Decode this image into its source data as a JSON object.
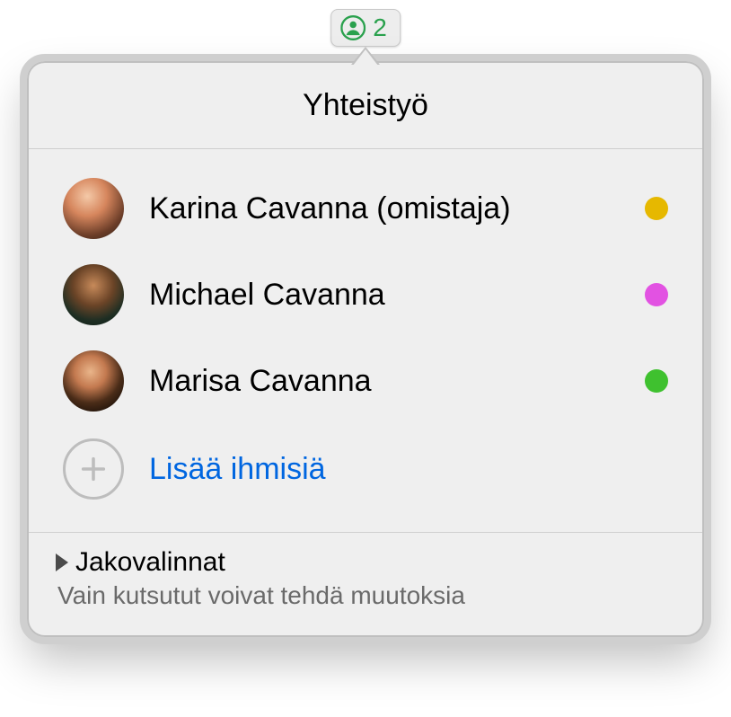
{
  "badge": {
    "count": "2"
  },
  "header": {
    "title": "Yhteistyö"
  },
  "participants": [
    {
      "name": "Karina Cavanna (omistaja)",
      "dot": "#e6b800"
    },
    {
      "name": "Michael Cavanna",
      "dot": "#e252e2"
    },
    {
      "name": "Marisa Cavanna",
      "dot": "#3fc12f"
    }
  ],
  "add": {
    "label": "Lisää ihmisiä"
  },
  "footer": {
    "title": "Jakovalinnat",
    "subtitle": "Vain kutsutut voivat tehdä muutoksia"
  }
}
